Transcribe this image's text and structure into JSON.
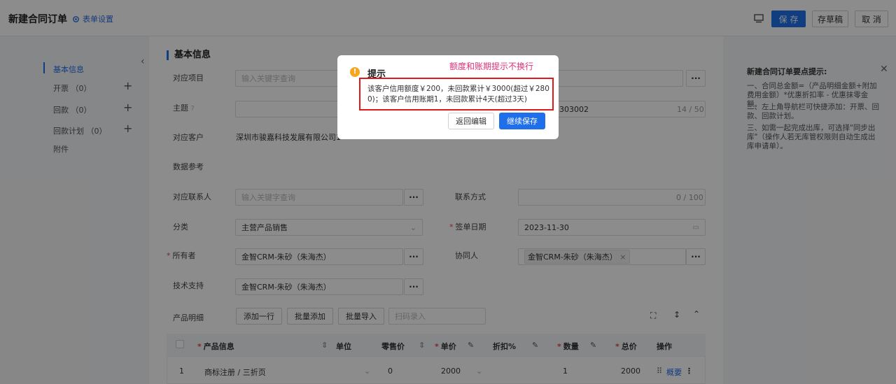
{
  "header": {
    "title": "新建合同订单",
    "form_settings": "表单设置",
    "save": "保 存",
    "draft": "存草稿",
    "cancel": "取 消"
  },
  "sidebar": {
    "items": [
      {
        "label": "基本信息"
      },
      {
        "label": "开票 （0）"
      },
      {
        "label": "回款 （0）"
      },
      {
        "label": "回款计划 （0）"
      },
      {
        "label": "附件"
      }
    ]
  },
  "form": {
    "section_title": "基本信息",
    "project_label": "对应项目",
    "project_placeholder": "输入关键字查询",
    "subject_label": "主题",
    "subject_value": "303002",
    "subject_counter": "14 / 50",
    "customer_label": "对应客户",
    "customer_value": "深圳市骏嘉科技发展有限公司1",
    "reference_label": "数据参考",
    "contact_label": "对应联系人",
    "contact_placeholder": "输入关键字查询",
    "phone_label": "联系方式",
    "phone_counter": "0 / 100",
    "category_label": "分类",
    "category_value": "主营产品销售",
    "sign_date_label": "签单日期",
    "sign_date_value": "2023-11-30",
    "owner_label": "所有者",
    "owner_value": "金智CRM-朱砂（朱海杰）",
    "collaborator_label": "协同人",
    "collaborator_tag": "金智CRM-朱砂（朱海杰）",
    "tech_label": "技术支持",
    "tech_value": "金智CRM-朱砂（朱海杰）",
    "products_label": "产品明细",
    "add_row": "添加一行",
    "batch_add": "批量添加",
    "batch_import": "批量导入",
    "scan_placeholder": "扫码录入"
  },
  "table": {
    "headers": [
      "产品信息",
      "单位",
      "零售价",
      "单价",
      "折扣%",
      "数量",
      "总价",
      "操作"
    ],
    "rows": [
      {
        "index": "1",
        "product": "商标注册 / 三折页",
        "unit": "",
        "retail": "0",
        "price": "2000",
        "discount": "",
        "qty": "1",
        "total": "2000",
        "action": "概要"
      }
    ]
  },
  "tips": {
    "title": "新建合同订单要点提示:",
    "lines": [
      "一、合同总金额=（产品明细金额+附加费用金额）*优惠折扣率 - 优惠抹零金额。",
      "二、左上角导航栏可快捷添加：开票、回款、回款计划。",
      "三、如需一起完成出库，可选择\"同步出库\"（操作人若无库管权限则自动生成出库申请单）。"
    ]
  },
  "dialog": {
    "title": "提示",
    "annotation": "额度和账期提示不换行",
    "message": "该客户信用额度￥200，未回款累计￥3000(超过￥2800)；该客户信用账期1，未回款累计4天(超过3天)",
    "back": "返回编辑",
    "continue": "继续保存"
  },
  "colors": {
    "accent": "#1f6feb",
    "required": "#e5484d",
    "highlight_border": "#e01818",
    "annotation": "#e0307a",
    "warning": "#f5a623"
  }
}
